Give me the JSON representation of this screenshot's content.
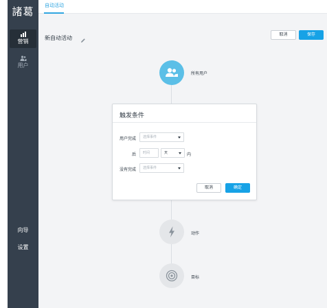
{
  "app": {
    "logo": "諸葛"
  },
  "sidebar": {
    "items": [
      {
        "label": "营销",
        "icon": "chart-icon",
        "active": true
      },
      {
        "label": "用户",
        "icon": "users-icon",
        "active": false
      }
    ],
    "bottom_items": [
      {
        "label": "向导"
      },
      {
        "label": "设置"
      }
    ]
  },
  "tabs": [
    {
      "label": "自动活动",
      "active": true
    }
  ],
  "header": {
    "title": "新自动活动",
    "cancel_label": "取消",
    "save_label": "保存"
  },
  "flow": {
    "nodes": [
      {
        "label": "所有用户",
        "icon": "users-icon",
        "state": "active"
      },
      {
        "label": "动作",
        "icon": "lightning-icon",
        "state": "inactive"
      },
      {
        "label": "目标",
        "icon": "target-icon",
        "state": "inactive"
      }
    ]
  },
  "modal": {
    "title": "触发条件",
    "rows": {
      "user_done_label": "用户完成",
      "user_done_placeholder": "选择事件",
      "after_label": "后",
      "time_placeholder": "时间",
      "unit_value": "天",
      "within_label": "内",
      "not_done_label": "没有完成",
      "not_done_placeholder": "选择事件"
    },
    "cancel_label": "取消",
    "confirm_label": "确定"
  },
  "colors": {
    "sidebar_bg": "#35404d",
    "accent": "#17a2e6",
    "content_bg": "#f3f4f6",
    "node_active": "#5bbfe7",
    "node_inactive": "#e4e6e9"
  }
}
